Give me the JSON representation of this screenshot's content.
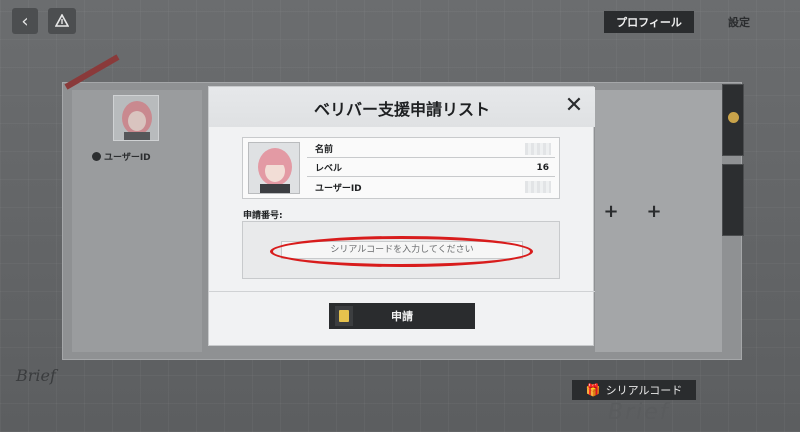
{
  "header": {
    "tabs": [
      {
        "label": "プロフィール",
        "active": true
      },
      {
        "label": "設定",
        "active": false
      }
    ]
  },
  "background": {
    "user_id_label": "ユーザーID",
    "serial_code_button": "シリアルコード",
    "signature": "Brief",
    "watermark": "Brief"
  },
  "modal": {
    "title": "ベリバー支援申請リスト",
    "fields": [
      {
        "label": "名前",
        "value": ""
      },
      {
        "label": "レベル",
        "value": "16"
      },
      {
        "label": "ユーザーID",
        "value": ""
      }
    ],
    "apply_number_label": "申請番号:",
    "serial_input": {
      "placeholder": "シリアルコードを入力してください",
      "value": ""
    },
    "submit_label": "申請"
  },
  "colors": {
    "accent_gold": "#c9a34a",
    "highlight_red": "#d81c1c",
    "dark_button": "#2a2c2e"
  }
}
